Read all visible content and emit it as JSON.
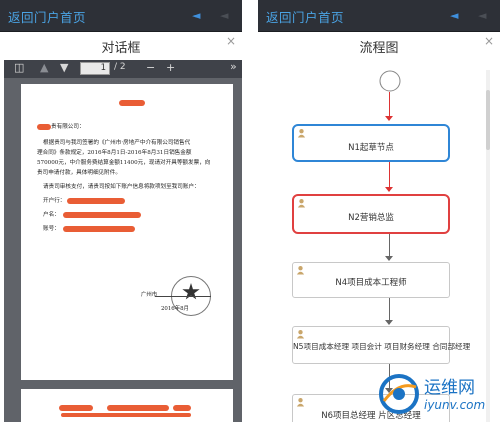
{
  "left": {
    "topbar": {
      "back_label": "返回门户首页"
    },
    "dialog": {
      "title": "对话框",
      "close": "×"
    },
    "pdf": {
      "page_current": "1",
      "page_total": "/ 2",
      "zoom_out": "−",
      "zoom_in": "+",
      "more": "»",
      "lines": [
        "贵有限公司：",
        "根据贵司与我司签署的《广州市·房地产中介有限公司销售代",
        "理合同》条款规定，2016年8月1日-2016年8月31日销售金额",
        "570000元，中介服务费结算金额11400元，现请对开具等额发票，向",
        "贵司申请付款，具体明细见附件。",
        "请贵司审核支付，请贵司按如下账户信息将款项划至我司账户：",
        "开户行：",
        "户名：",
        "账号："
      ],
      "seal_lines": [
        "广州市",
        "2016年8月"
      ]
    }
  },
  "right": {
    "topbar": {
      "back_label": "返回门户首页"
    },
    "dialog": {
      "title": "流程图",
      "close": "×"
    },
    "nodes": [
      {
        "label": "N1起草节点",
        "style": "blue"
      },
      {
        "label": "N2营销总监",
        "style": "red"
      },
      {
        "label": "N4项目成本工程师",
        "style": "normal"
      },
      {
        "label": "N5项目成本经理 项目会计 项目财务经理 合同部经理",
        "style": "normal"
      },
      {
        "label": "N6项目总经理 片区总经理",
        "style": "normal"
      }
    ],
    "colors": {
      "blue": "#2f86d6",
      "red": "#e04040",
      "topbar": "#2d3037"
    }
  },
  "watermark": {
    "text": "运维网",
    "url": "iyunv.com"
  }
}
